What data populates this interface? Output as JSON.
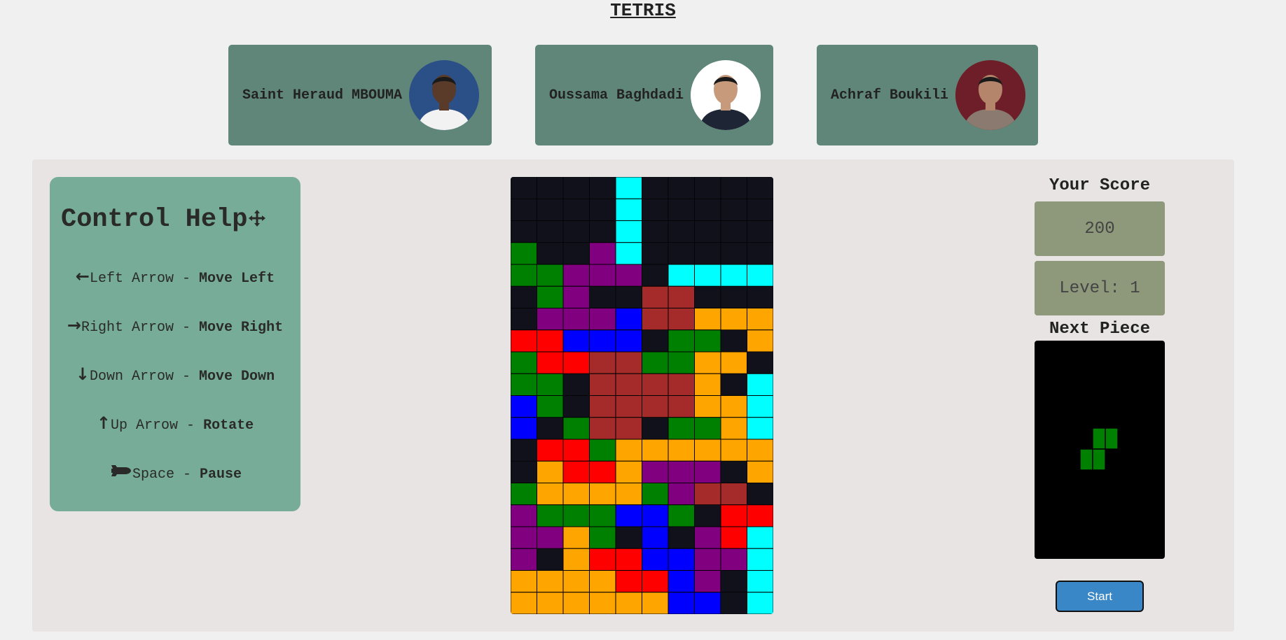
{
  "title": "TETRIS",
  "team": [
    {
      "name": "Saint Heraud MBOUMA",
      "avatar_bg": "#2b4f87",
      "skin": "#5a3a28",
      "shirt": "#f2f2f2"
    },
    {
      "name": "Oussama Baghdadi",
      "avatar_bg": "#ffffff",
      "skin": "#c69a7a",
      "shirt": "#1e2636"
    },
    {
      "name": "Achraf Boukili",
      "avatar_bg": "#6e1e28",
      "skin": "#b4856a",
      "shirt": "#8a7a70"
    }
  ],
  "controls": {
    "heading": "Control Help",
    "heading_icon": "move-icon",
    "items": [
      {
        "icon": "arrow-left-icon",
        "glyph": "←",
        "key": "Left Arrow - ",
        "action": "Move Left"
      },
      {
        "icon": "arrow-right-icon",
        "glyph": "→",
        "key": "Right Arrow - ",
        "action": "Move Right"
      },
      {
        "icon": "arrow-down-icon",
        "glyph": "↓",
        "key": "Down Arrow - ",
        "action": "Move Down"
      },
      {
        "icon": "arrow-up-icon",
        "glyph": "↑",
        "key": "Up Arrow - ",
        "action": "Rotate"
      },
      {
        "icon": "pause-icon",
        "glyph": "",
        "key": "Space - ",
        "action": "Pause"
      }
    ]
  },
  "score": {
    "label": "Your Score",
    "value": "200",
    "level": "Level: 1"
  },
  "next_piece": {
    "label": "Next Piece",
    "shape": "S",
    "color": "#008000",
    "cells": [
      [
        1,
        0
      ],
      [
        2,
        0
      ],
      [
        0,
        1
      ],
      [
        1,
        1
      ]
    ]
  },
  "start_label": "Start",
  "colors": {
    ".": "#10111a",
    "C": "#00ffff",
    "G": "#008000",
    "P": "#800080",
    "B": "#0000ff",
    "R": "#ff0000",
    "D": "#a52a2a",
    "O": "#ffa500"
  },
  "board": {
    "columns": 10,
    "rows": [
      "....C.....",
      "....C.....",
      "....C.....",
      "G..PC.....",
      "GGPPP.CCCC",
      ".GP..DD...",
      ".PPPBDDOOO",
      "RRBBB.GG.O",
      "GRRDDGGOO.",
      "GG.DDDDO.C",
      "BG.DDDDOOC",
      "B.GDD.GGOC",
      ".RRGOOOOOO",
      ".ORROPPP.O",
      "GOOOOGPDD.",
      "PGGGBBG.RR",
      "PPOG.B.PRC",
      "P.ORRBBPPC",
      "OOOORRBP.C",
      "OOOOOOBB.C"
    ]
  }
}
